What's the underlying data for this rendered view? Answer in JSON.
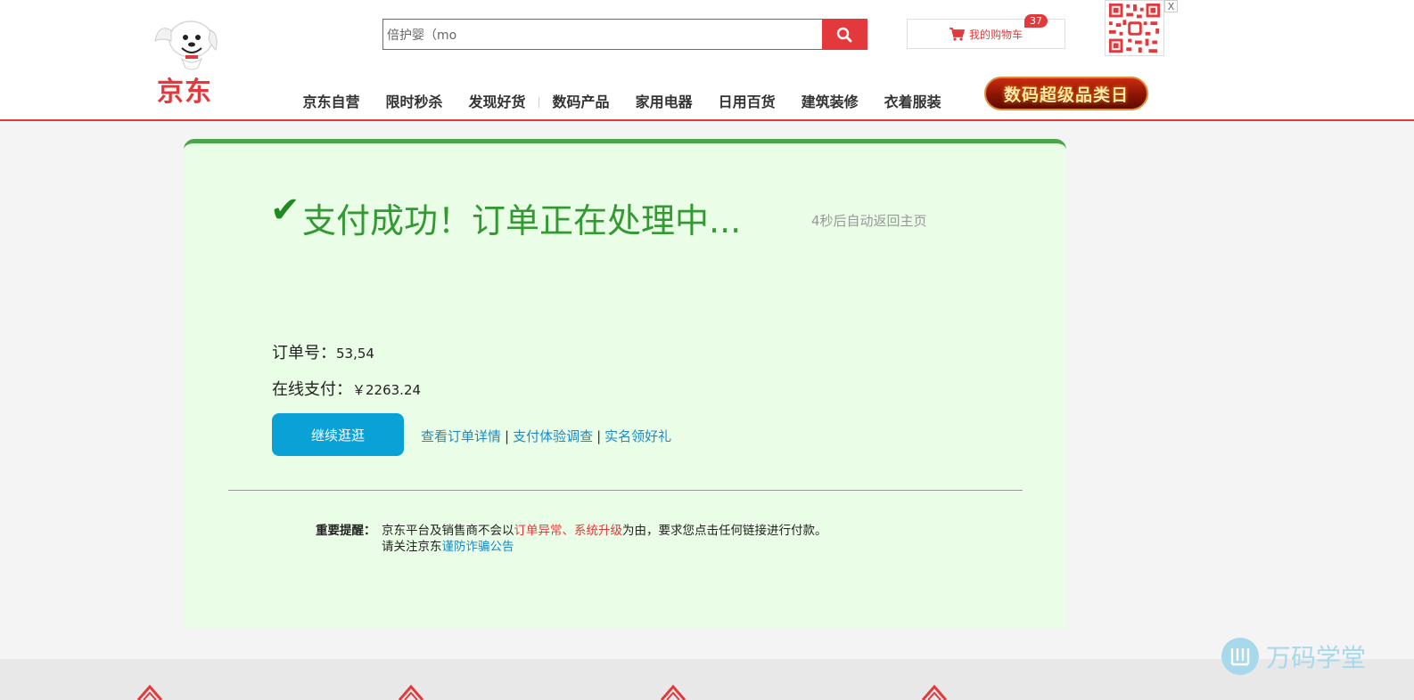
{
  "header": {
    "logo_text": "京东",
    "search": {
      "value": "倍护婴（mo",
      "placeholder": ""
    },
    "cart": {
      "label": "我的购物车",
      "count": "37"
    },
    "qr_close": "X",
    "nav": [
      "京东自营",
      "限时秒杀",
      "发现好货",
      "数码产品",
      "家用电器",
      "日用百货",
      "建筑装修",
      "衣着服装"
    ],
    "promo_banner": "数码超级品类日"
  },
  "result": {
    "check_mark": "✔",
    "title": "支付成功！订单正在处理中...",
    "countdown": "4秒后自动返回主页",
    "order_label": "订单号：",
    "order_value": "53,54",
    "pay_label": "在线支付：",
    "pay_value": "￥2263.24",
    "continue_button": "继续逛逛",
    "links": [
      "查看订单详情",
      "支付体验调查",
      "实名领好礼"
    ]
  },
  "notice": {
    "label": "重要提醒：",
    "line1_a": "京东平台及销售商不会以",
    "line1_red": "订单异常、系统升级",
    "line1_b": "为由，要求您点击任何链接进行付款。",
    "line2_a": "请关注京东",
    "line2_link": "谨防诈骗公告"
  },
  "watermark": {
    "text": "万码学堂"
  },
  "colors": {
    "brand_red": "#e4393c",
    "success_green": "#339933",
    "card_bg": "#eafde6",
    "button_blue": "#0aa1d6",
    "link_blue": "#1c8ac7"
  }
}
